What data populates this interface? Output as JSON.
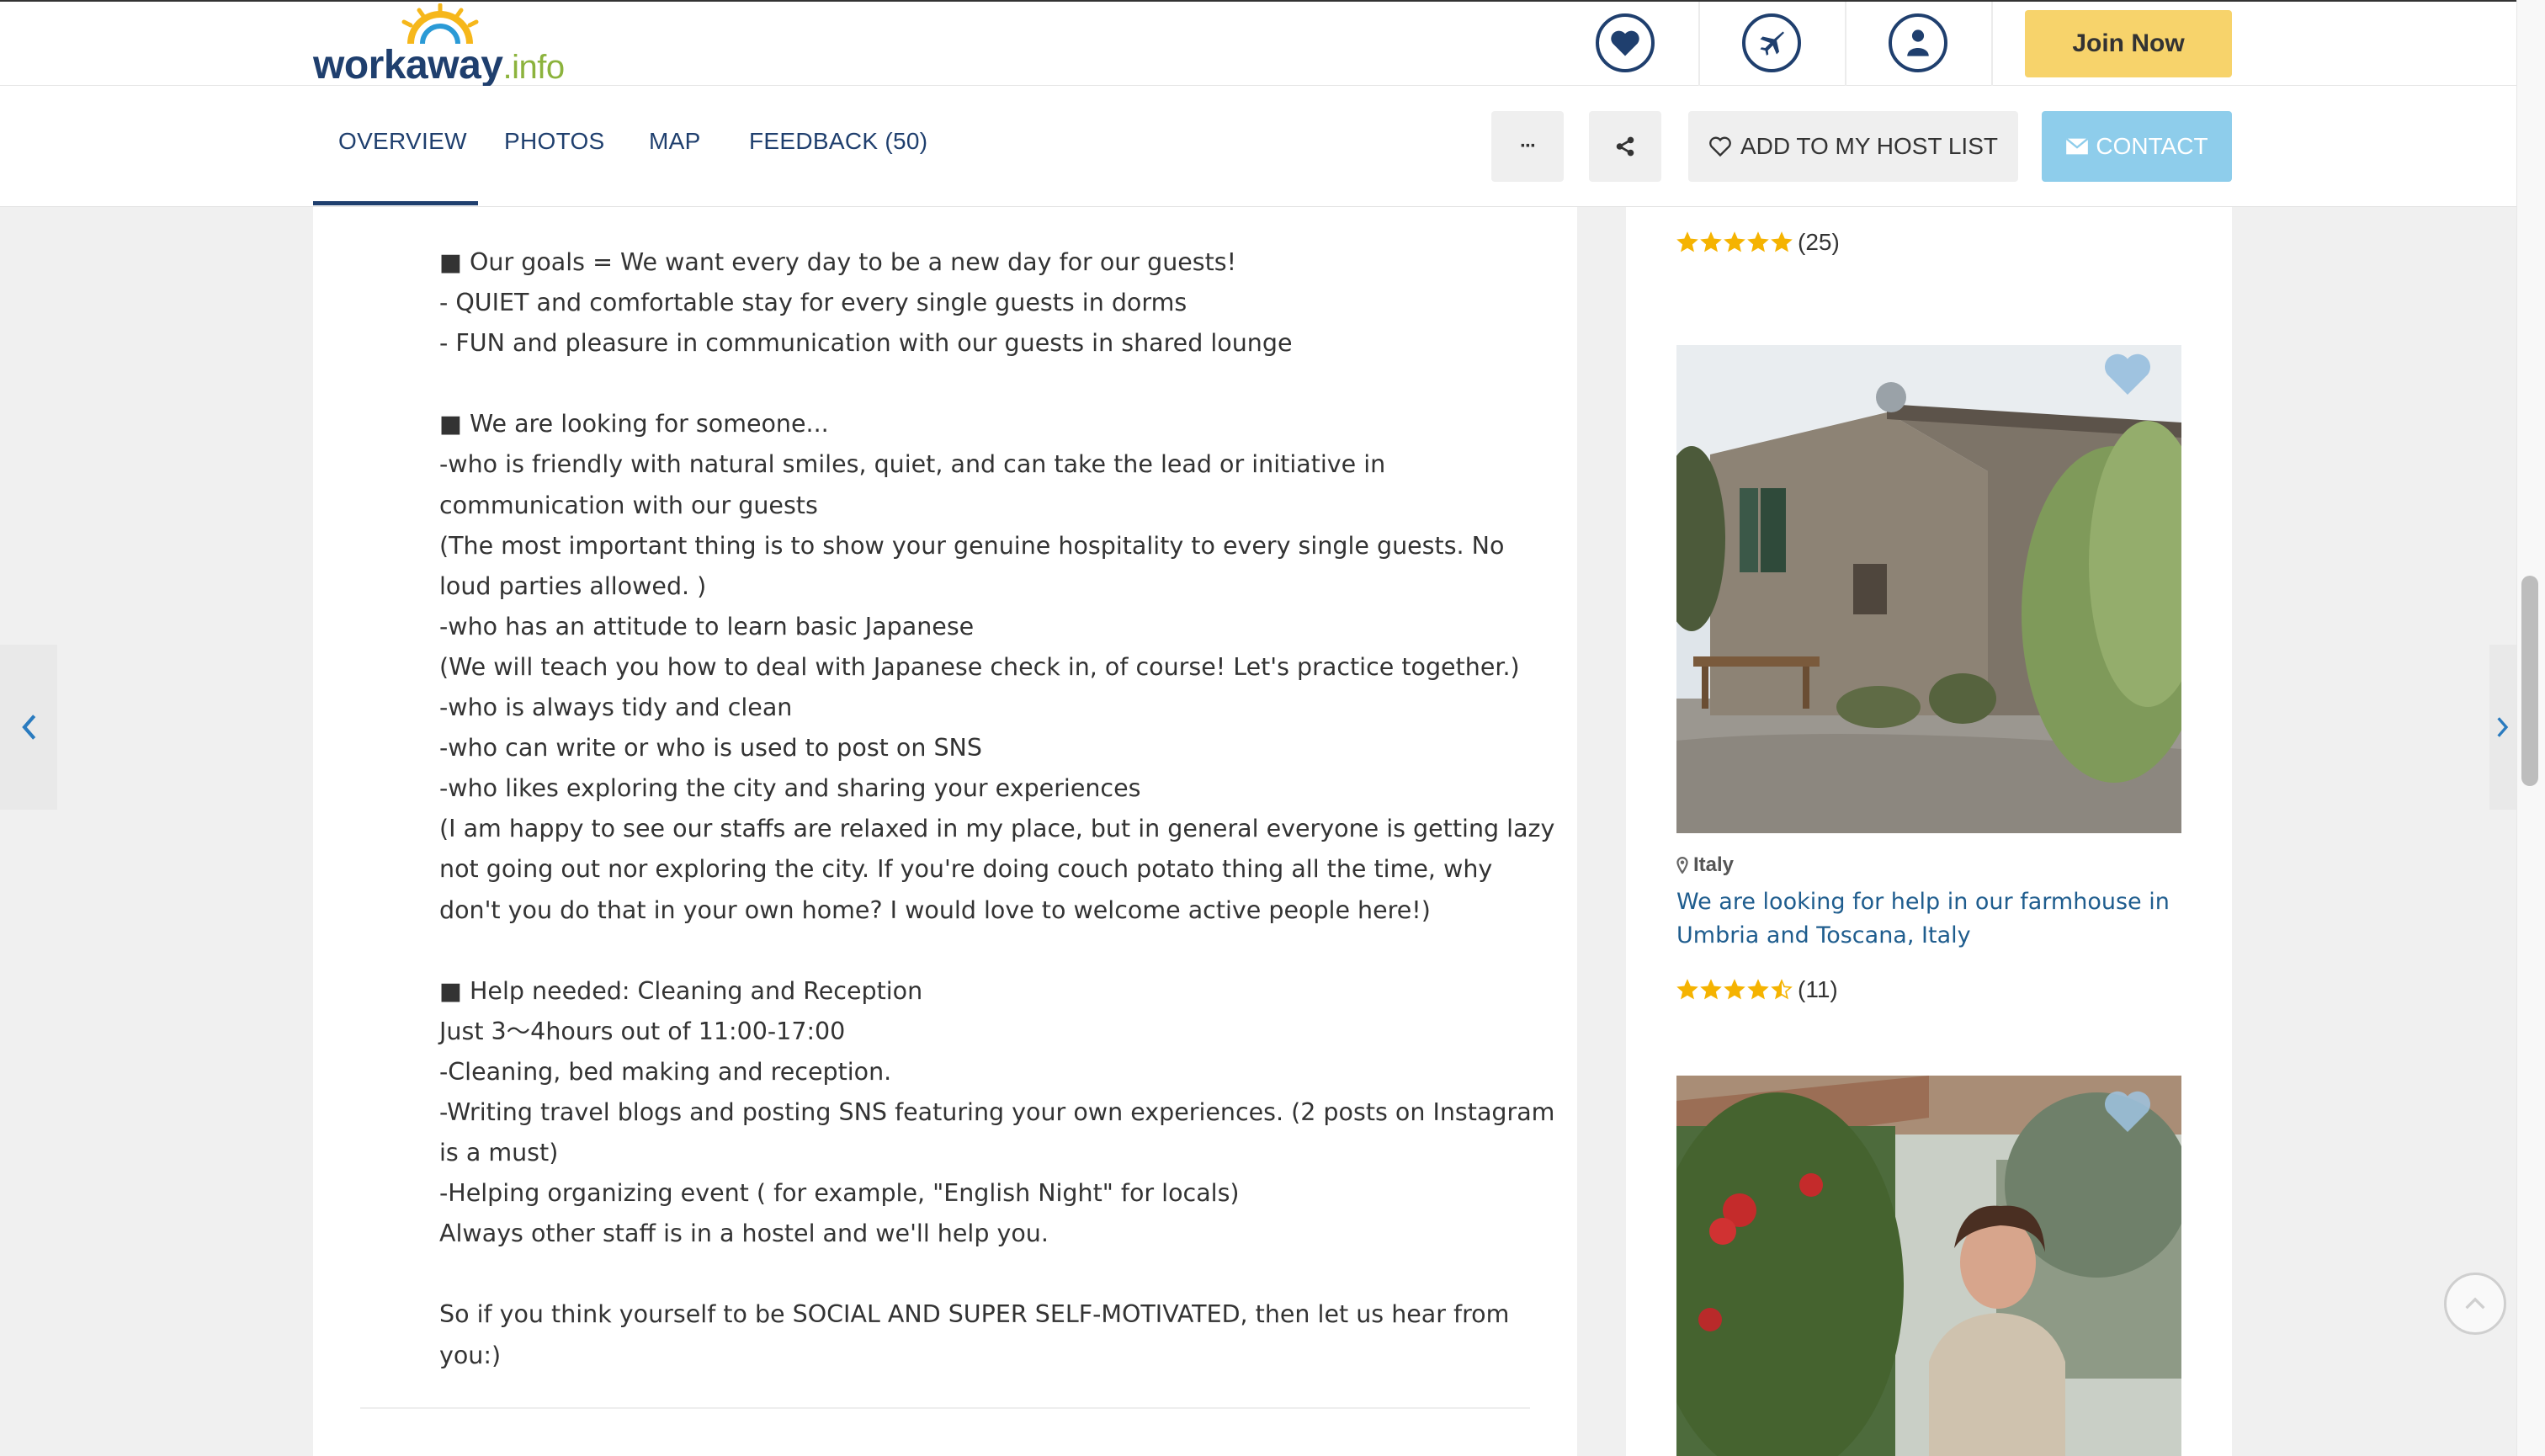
{
  "brand": {
    "logo_main": "workaway",
    "logo_suffix": ".info"
  },
  "header": {
    "icons": [
      "heart-icon",
      "plane-icon",
      "user-icon"
    ],
    "join_label": "Join Now"
  },
  "subnav": {
    "tabs": [
      {
        "label": "OVERVIEW",
        "active": true
      },
      {
        "label": "PHOTOS",
        "active": false
      },
      {
        "label": "MAP",
        "active": false
      },
      {
        "label": "FEEDBACK (50)",
        "active": false
      }
    ],
    "more_label": "···",
    "host_list_label": "ADD TO MY HOST LIST",
    "contact_label": "CONTACT"
  },
  "description": {
    "lines": [
      "■ Our goals = We want every day to be a new day for our guests!",
      "- QUIET and comfortable stay for every single guests in dorms",
      "- FUN and pleasure in communication with our guests in shared lounge",
      "",
      "■ We are looking for someone...",
      "-who is friendly with natural smiles, quiet, and can take the lead or initiative in",
      "communication with our guests",
      "(The most important thing is to show your genuine hospitality to every single guests. No",
      "loud parties allowed. )",
      "-who has an attitude to learn basic Japanese",
      "(We will teach you how to deal with Japanese check in, of course! Let's practice together.)",
      "-who is always tidy and clean",
      "-who can write or who is used to post on SNS",
      "-who likes exploring the city and sharing your experiences",
      "(I am happy to see our staffs are relaxed in my place, but in general everyone is getting lazy",
      "not going out nor exploring the city. If you're doing couch potato thing all the time, why",
      "don't you do that in your own home? I would love to welcome active people here!)",
      "",
      "■ Help needed: Cleaning and Reception",
      "Just 3〜4hours out of 11:00-17:00",
      "-Cleaning, bed making and reception.",
      "-Writing travel blogs and posting SNS featuring your own experiences. (2 posts on Instagram",
      "is a must)",
      "-Helping organizing event ( for example, \"English Night\" for locals)",
      "Always other staff is in a hostel and we'll help you.",
      "",
      "So if you think yourself to be SOCIAL AND SUPER SELF-MOTIVATED, then let us hear from",
      "you:)"
    ]
  },
  "sidebar": {
    "cards": [
      {
        "rating": 5,
        "count": "(25)"
      },
      {
        "location": "Italy",
        "title": "We are looking for help in our farmhouse in Umbria and Toscana, Italy",
        "rating": 4.5,
        "count": "(11)"
      }
    ]
  },
  "colors": {
    "navy": "#1f3f6e",
    "link": "#1f5d8e",
    "join": "#f7d36b",
    "contact": "#8ecdeb",
    "star": "#f5b301",
    "heart": "#9fc3e0"
  }
}
